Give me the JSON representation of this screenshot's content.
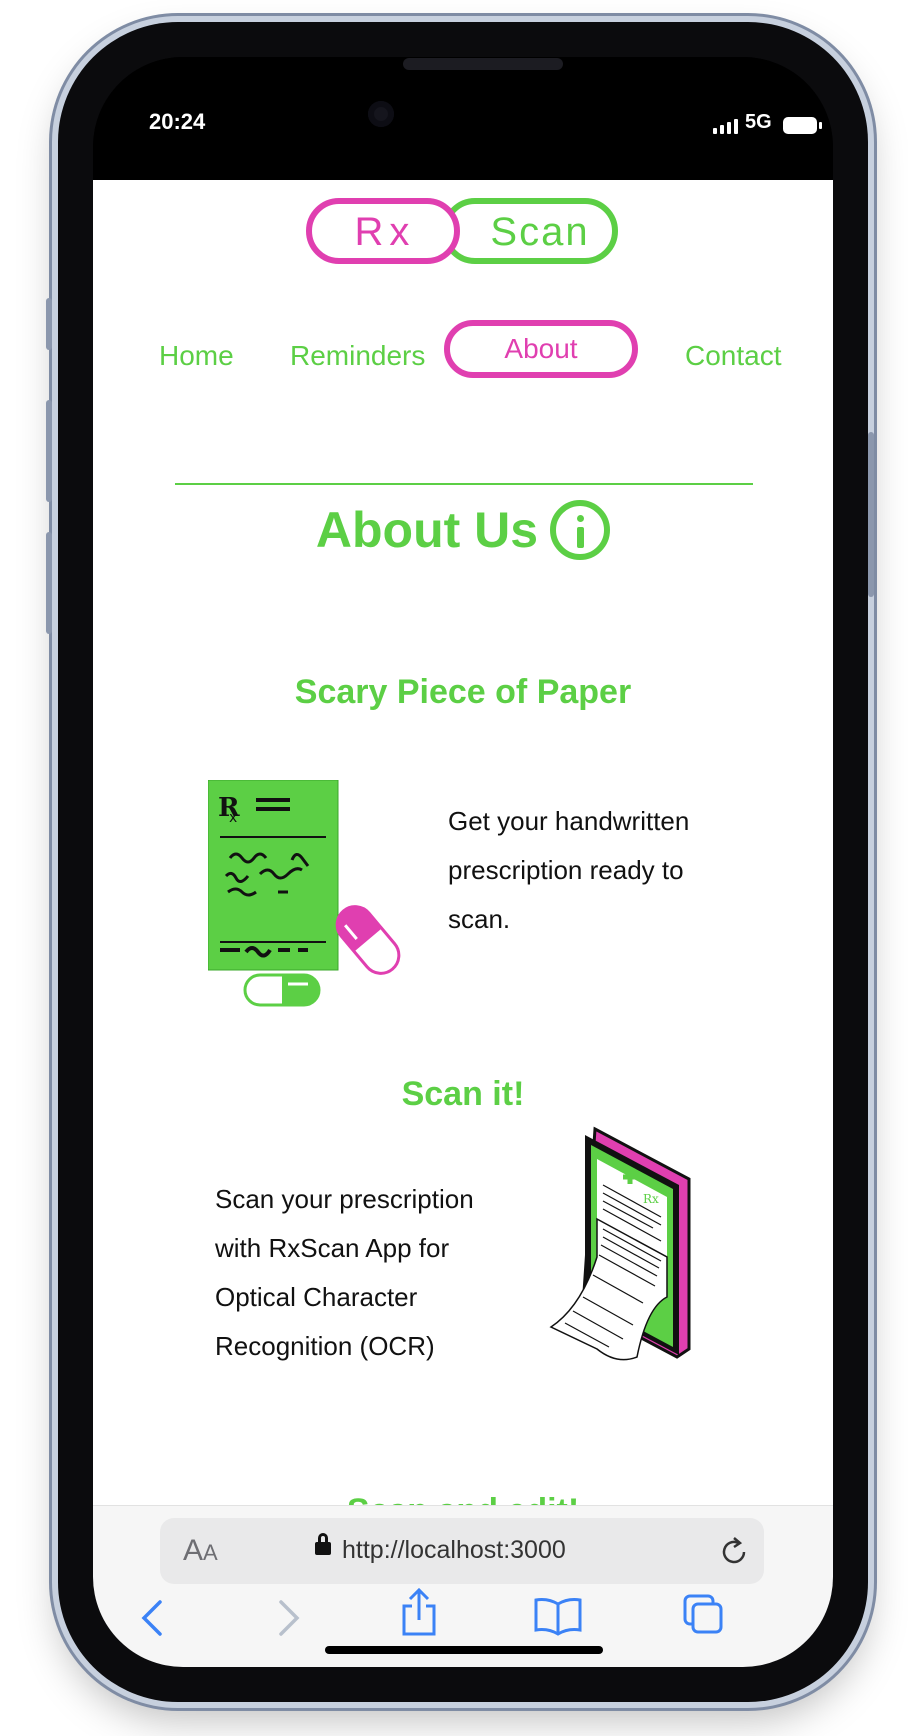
{
  "status": {
    "time": "20:24",
    "network": "5G"
  },
  "logo": {
    "part1": "Rx",
    "part2": "Scan"
  },
  "nav": {
    "home": "Home",
    "reminders": "Reminders",
    "about": "About",
    "contact": "Contact"
  },
  "heading": "About Us",
  "sections": [
    {
      "title": "Scary Piece of Paper",
      "text": [
        "Get your handwritten",
        "prescription ready to",
        "scan."
      ]
    },
    {
      "title": "Scan it!",
      "text": [
        "Scan your prescription",
        "with RxScan App for",
        "Optical Character",
        "Recognition (OCR)"
      ]
    }
  ],
  "next_section_partial": "Scan and edit!",
  "browser": {
    "aa_large": "A",
    "aa_small": "A",
    "url": "http://localhost:3000"
  },
  "colors": {
    "green": "#5ccf45",
    "pink": "#e03fb0",
    "ios_blue": "#3b82f6"
  },
  "icons": [
    "back-icon",
    "forward-icon",
    "share-icon",
    "bookmarks-icon",
    "tabs-icon",
    "reload-icon",
    "lock-icon",
    "info-icon"
  ]
}
